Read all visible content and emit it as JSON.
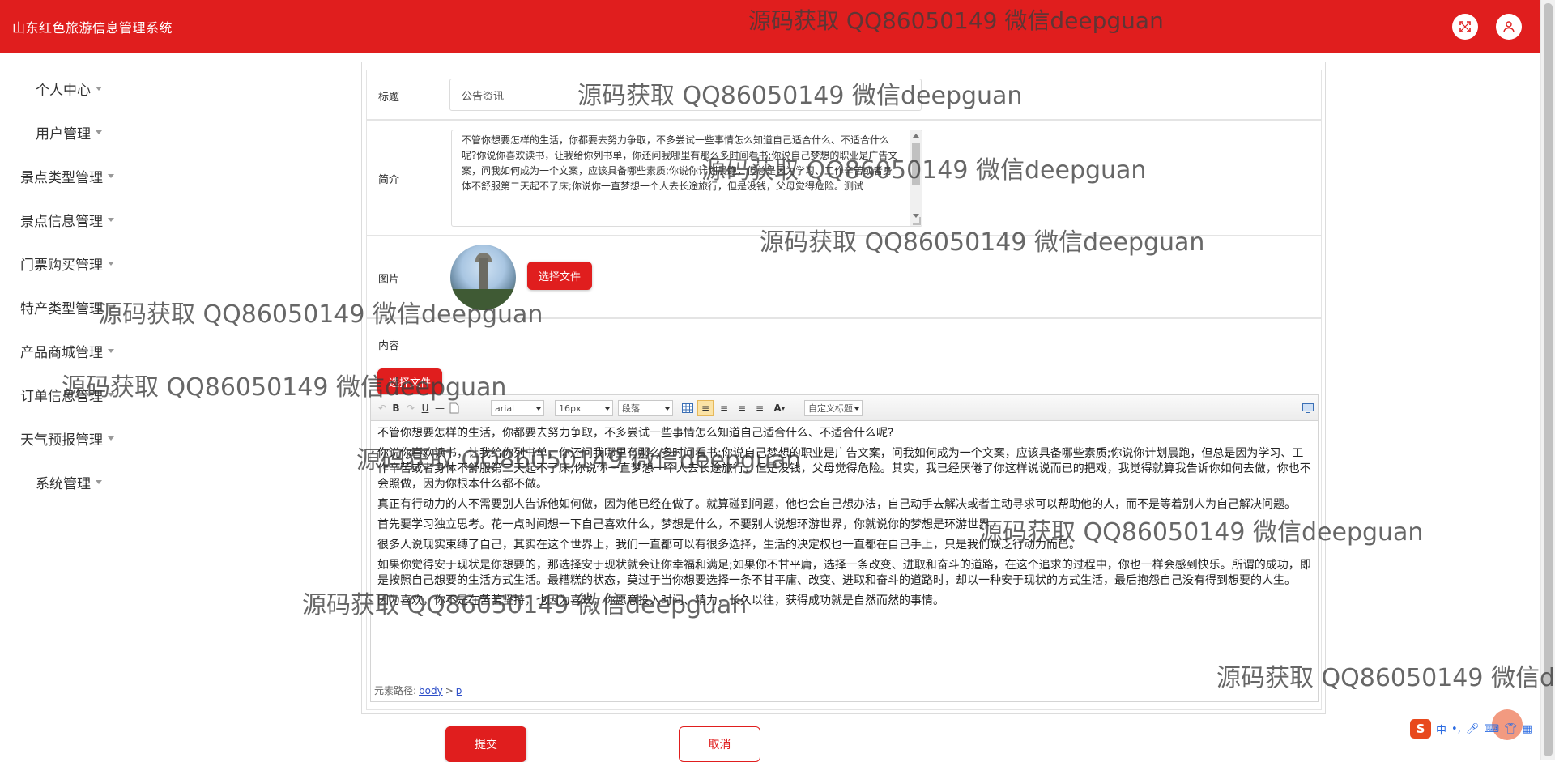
{
  "app": {
    "title": "山东红色旅游信息管理系统"
  },
  "header": {
    "icons": [
      "fullscreen-icon",
      "user-icon"
    ]
  },
  "sidebar": {
    "items": [
      {
        "label": "个人中心"
      },
      {
        "label": "用户管理"
      },
      {
        "label": "景点类型管理"
      },
      {
        "label": "景点信息管理"
      },
      {
        "label": "门票购买管理"
      },
      {
        "label": "特产类型管理"
      },
      {
        "label": "产品商城管理"
      },
      {
        "label": "订单信息管理"
      },
      {
        "label": "天气预报管理"
      },
      {
        "label": "系统管理"
      }
    ]
  },
  "form": {
    "title_label": "标题",
    "title_value": "公告资讯",
    "summary_label": "简介",
    "summary_value": "不管你想要怎样的生活，你都要去努力争取，不多尝试一些事情怎么知道自己适合什么、不适合什么呢?你说你喜欢读书，让我给你列书单，你还问我哪里有那么多时间看书;你说自己梦想的职业是广告文案，问我如何成为一个文案，应该具备哪些素质;你说你计划晨跑，但总是因为学习、工作辛苦或者身体不舒服第二天起不了床;你说你一直梦想一个人去长途旅行，但是没钱，父母觉得危险。测试",
    "image_label": "图片",
    "choose_file_label": "选择文件",
    "content_label": "内容",
    "content_choose_file_label": "选择文件",
    "submit_label": "提交",
    "cancel_label": "取消"
  },
  "editor": {
    "font_family": "arial",
    "font_size": "16px",
    "paragraph": "段落",
    "custom_title": "自定义标题",
    "font_color_label": "A",
    "paragraphs": [
      "不管你想要怎样的生活，你都要去努力争取，不多尝试一些事情怎么知道自己适合什么、不适合什么呢?",
      "你说你喜欢读书，让我给你列书单，你还问我哪里有那么多时间看书;你说自己梦想的职业是广告文案，问我如何成为一个文案，应该具备哪些素质;你说你计划晨跑，但总是因为学习、工作辛苦或者身体不舒服第二天起不了床;你说你一直梦想一个人去长途旅行，但是没钱，父母觉得危险。其实，我已经厌倦了你这样说说而已的把戏，我觉得就算我告诉你如何去做，你也不会照做，因为你根本什么都不做。",
      "真正有行动力的人不需要别人告诉他如何做，因为他已经在做了。就算碰到问题，他也会自己想办法，自己动手去解决或者主动寻求可以帮助他的人，而不是等着别人为自己解决问题。",
      "首先要学习独立思考。花一点时间想一下自己喜欢什么，梦想是什么，不要别人说想环游世界，你就说你的梦想是环游世界。",
      "很多人说现实束缚了自己，其实在这个世界上，我们一直都可以有很多选择，生活的决定权也一直都在自己手上，只是我们缺乏行动力而已。",
      "如果你觉得安于现状是你想要的，那选择安于现状就会让你幸福和满足;如果你不甘平庸，选择一条改变、进取和奋斗的道路，在这个追求的过程中，你也一样会感到快乐。所谓的成功，即是按照自己想要的生活方式生活。最糟糕的状态，莫过于当你想要选择一条不甘平庸、改变、进取和奋斗的道路时，却以一种安于现状的方式生活，最后抱怨自己没有得到想要的人生。",
      "因为喜欢，你不是在苦苦坚持，也因为喜欢，你愿意投入时间、精力，长久以往，获得成功就是自然而然的事情。"
    ],
    "path_label": "元素路径:",
    "path_body": "body",
    "path_sep": ">",
    "path_p": "p"
  },
  "watermark": {
    "text": "源码获取 QQ86050149 微信deepguan",
    "text_clipped": "源码获取 QQ86050149 微信de"
  },
  "ime": {
    "logo": "S",
    "lang": "中",
    "punct": "•,",
    "icons": [
      "mic-icon",
      "keyboard-icon",
      "skin-icon",
      "grid-icon"
    ]
  },
  "colors": {
    "brand": "#e01e1e",
    "text": "#333333"
  }
}
